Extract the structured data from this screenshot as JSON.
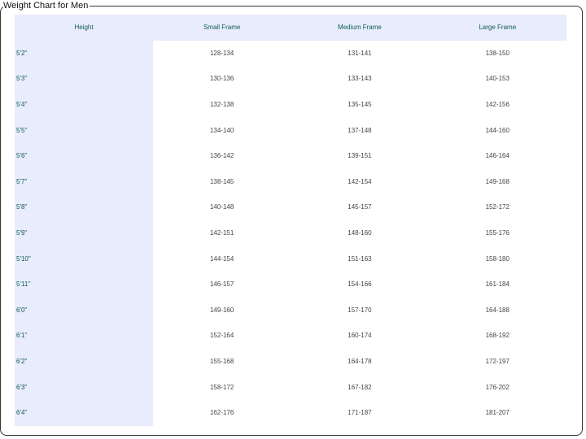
{
  "title": "Weight Chart for Men",
  "headers": [
    "Height",
    "Small Frame",
    "Medium Frame",
    "Large Frame"
  ],
  "rows": [
    [
      "5'2\"",
      "128-134",
      "131-141",
      "138-150"
    ],
    [
      "5'3\"",
      "130-136",
      "133-143",
      "140-153"
    ],
    [
      "5'4\"",
      "132-138",
      "135-145",
      "142-156"
    ],
    [
      "5'5\"",
      "134-140",
      "137-148",
      "144-160"
    ],
    [
      "5'6\"",
      "136-142",
      "139-151",
      "146-164"
    ],
    [
      "5'7\"",
      "138-145",
      "142-154",
      "149-168"
    ],
    [
      "5'8\"",
      "140-148",
      "145-157",
      "152-172"
    ],
    [
      "5'9\"",
      "142-151",
      "148-160",
      "155-176"
    ],
    [
      "5'10\"",
      "144-154",
      "151-163",
      "158-180"
    ],
    [
      "5'11\"",
      "146-157",
      "154-166",
      "161-184"
    ],
    [
      "6'0\"",
      "149-160",
      "157-170",
      "164-188"
    ],
    [
      "6'1\"",
      "152-164",
      "160-174",
      "168-192"
    ],
    [
      "6'2\"",
      "155-168",
      "164-178",
      "172-197"
    ],
    [
      "6'3\"",
      "158-172",
      "167-182",
      "176-202"
    ],
    [
      "6'4\"",
      "162-176",
      "171-187",
      "181-207"
    ]
  ]
}
